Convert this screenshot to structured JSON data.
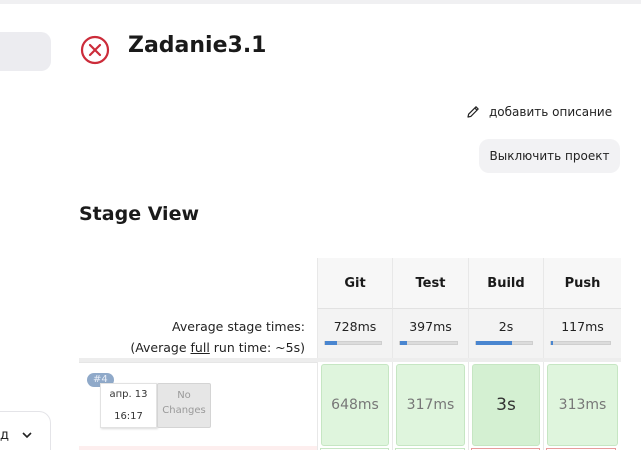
{
  "job": {
    "title": "Zadanie3.1",
    "status_icon": "failed-x-circle-icon",
    "status_color": "#cc2c3a"
  },
  "actions": {
    "add_description": "добавить описание",
    "disable_project": "Выключить проект"
  },
  "sidebar": {
    "bottom_text": "д"
  },
  "stage_view": {
    "title": "Stage View",
    "stages": [
      "Git",
      "Test",
      "Build",
      "Push"
    ],
    "avg_label": "Average stage times:",
    "avg_full_prefix": "(Average ",
    "avg_full_link": "full",
    "avg_full_suffix": " run time: ~5s)",
    "avg_times": [
      "728ms",
      "397ms",
      "2s",
      "117ms"
    ],
    "avg_progress": [
      0.22,
      0.12,
      0.65,
      0.03
    ],
    "build": {
      "number": "#4",
      "date": "апр. 13",
      "time": "16:17",
      "changes_line1": "No",
      "changes_line2": "Changes",
      "durations": [
        "648ms",
        "317ms",
        "3s",
        "313ms"
      ]
    }
  }
}
